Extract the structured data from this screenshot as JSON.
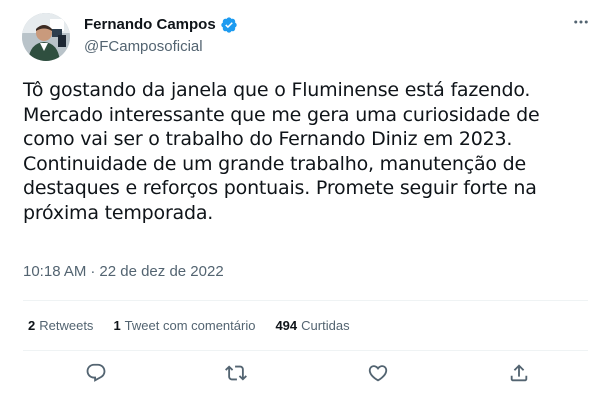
{
  "author": {
    "display_name": "Fernando Campos",
    "handle": "@FCamposoficial",
    "verified": true
  },
  "tweet": {
    "text": "Tô gostando da janela que o Fluminense está fazendo.\nMercado interessante que me gera uma curiosidade de\ncomo vai ser o trabalho do Fernando Diniz em 2023.\nContinuidade de um grande trabalho, manutenção de\ndestaques e reforços pontuais. Promete seguir forte na\npróxima temporada.",
    "time": "10:18 AM",
    "separator": "·",
    "date": "22 de dez de 2022"
  },
  "stats": {
    "retweets_count": "2",
    "retweets_label": "Retweets",
    "quotes_count": "1",
    "quotes_label": "Tweet com comentário",
    "likes_count": "494",
    "likes_label": "Curtidas"
  },
  "icons": {
    "verified": "verified-badge-icon",
    "more": "more-dots-icon",
    "reply": "reply-icon",
    "retweet": "retweet-icon",
    "like": "heart-icon",
    "share": "share-icon"
  },
  "colors": {
    "text": "#0f1419",
    "secondary": "#536471",
    "verified": "#1d9bf0",
    "divider": "#eff3f4"
  }
}
